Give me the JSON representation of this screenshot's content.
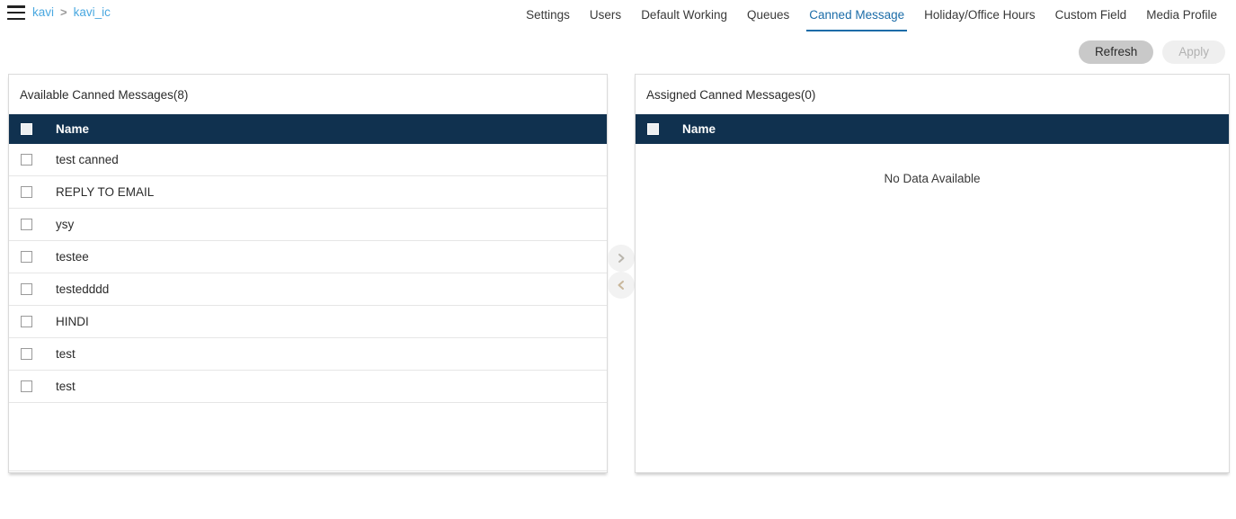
{
  "header": {
    "menu_icon": "hamburger-menu-icon",
    "breadcrumb": {
      "root": "kavi",
      "separator": ">",
      "current": "kavi_ic"
    },
    "tabs": [
      {
        "label": "Settings",
        "active": false
      },
      {
        "label": "Users",
        "active": false
      },
      {
        "label": "Default Working",
        "active": false
      },
      {
        "label": "Queues",
        "active": false
      },
      {
        "label": "Canned Message",
        "active": true
      },
      {
        "label": "Holiday/Office Hours",
        "active": false
      },
      {
        "label": "Custom Field",
        "active": false
      },
      {
        "label": "Media Profile",
        "active": false
      }
    ]
  },
  "actions": {
    "refresh_label": "Refresh",
    "apply_label": "Apply"
  },
  "available_panel": {
    "title": "Available Canned Messages(8)",
    "column_header": "Name",
    "rows": [
      {
        "name": "test canned"
      },
      {
        "name": "REPLY TO EMAIL"
      },
      {
        "name": "ysy"
      },
      {
        "name": "testee"
      },
      {
        "name": "testedddd"
      },
      {
        "name": "HINDI"
      },
      {
        "name": "test"
      },
      {
        "name": "test"
      }
    ]
  },
  "assigned_panel": {
    "title": "Assigned Canned Messages(0)",
    "column_header": "Name",
    "empty_message": "No Data Available",
    "rows": []
  },
  "transfer": {
    "assign_icon": "chevron-right-icon",
    "unassign_icon": "chevron-left-icon"
  },
  "colors": {
    "table_header_bg": "#10314f",
    "accent_link": "#4aa8e0",
    "active_tab": "#1b6ca8",
    "refresh_bg": "#c9c9c9",
    "apply_bg": "#efefef"
  }
}
